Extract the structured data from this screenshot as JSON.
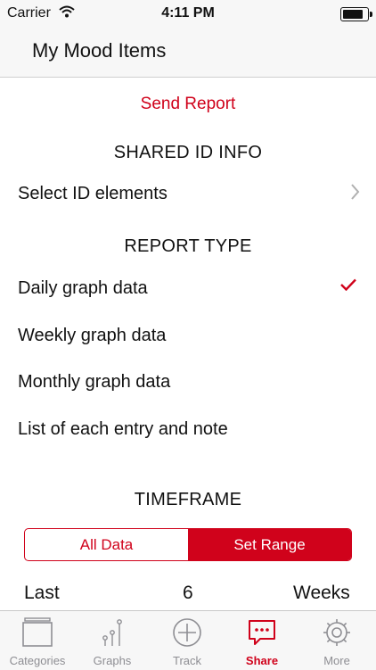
{
  "status_bar": {
    "carrier": "Carrier",
    "time": "4:11 PM"
  },
  "nav": {
    "title": "My Mood Items"
  },
  "send_report": "Send Report",
  "shared_id": {
    "header": "SHARED ID INFO",
    "select_label": "Select ID elements"
  },
  "report_type": {
    "header": "REPORT TYPE",
    "options": [
      "Daily graph data",
      "Weekly graph data",
      "Monthly graph data",
      "List of each entry and note"
    ],
    "selected": "Daily graph data"
  },
  "timeframe": {
    "header": "TIMEFRAME",
    "segments": [
      "All Data",
      "Set Range"
    ],
    "selected_segment": "Set Range",
    "range_prefix": "Last",
    "range_value": "6",
    "range_unit": "Weeks"
  },
  "tabs": [
    {
      "label": "Categories",
      "icon": "categories-icon"
    },
    {
      "label": "Graphs",
      "icon": "graphs-icon"
    },
    {
      "label": "Track",
      "icon": "add-circle-icon"
    },
    {
      "label": "Share",
      "icon": "share-message-icon"
    },
    {
      "label": "More",
      "icon": "gear-icon"
    }
  ],
  "active_tab": "Share",
  "colors": {
    "accent": "#d0021b",
    "bar_bg": "#f7f7f7",
    "inactive": "#8e8e93"
  }
}
